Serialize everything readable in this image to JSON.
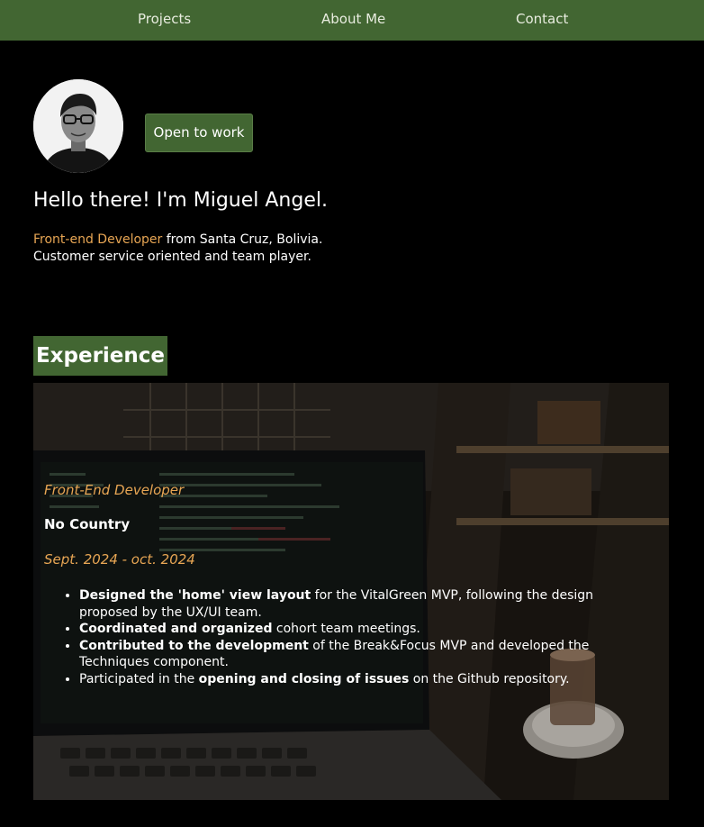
{
  "nav": {
    "items": [
      "Projects",
      "About Me",
      "Contact"
    ]
  },
  "profile": {
    "open_to_work_label": "Open to work",
    "greeting": "Hello there! I'm Miguel Angel.",
    "role": "Front-end Developer",
    "location_text": " from Santa Cruz, Bolivia.",
    "tagline": "Customer service oriented and team player."
  },
  "experience": {
    "section_title": "Experience",
    "job": {
      "title": "Front-End Developer",
      "company": "No Country",
      "dates": "Sept. 2024 - oct. 2024",
      "duties": [
        {
          "bold": "Designed the 'home' view layout",
          "rest": " for the VitalGreen MVP, following the design proposed by the UX/UI team."
        },
        {
          "bold": "Coordinated and organized",
          "rest": " cohort team meetings."
        },
        {
          "bold": "Contributed to the development",
          "rest": " of the Break&Focus MVP and developed the Techniques component."
        },
        {
          "pre": "Participated in the ",
          "bold": "opening and closing of issues",
          "rest": " on the Github repository."
        }
      ]
    }
  },
  "colors": {
    "accent_green": "#426632",
    "accent_orange": "#e8a654",
    "background": "#000000"
  }
}
